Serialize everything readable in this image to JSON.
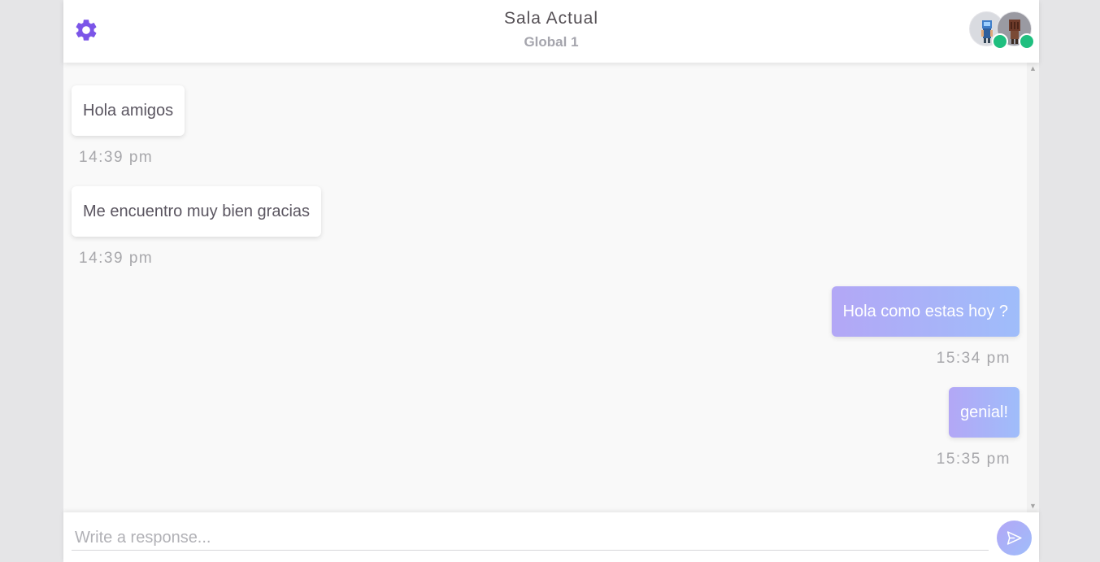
{
  "header": {
    "title": "Sala Actual",
    "subtitle": "Global 1",
    "settings_icon": "gear-icon",
    "online_color": "#1fbf7f",
    "accent_color": "#7b55e8"
  },
  "messages": [
    {
      "side": "left",
      "text": "Hola amigos",
      "time": "14:39 pm"
    },
    {
      "side": "left",
      "text": "Me encuentro muy bien gracias",
      "time": "14:39 pm"
    },
    {
      "side": "right",
      "text": "Hola como estas hoy ?",
      "time": "15:34 pm"
    },
    {
      "side": "right",
      "text": "genial!",
      "time": "15:35 pm"
    }
  ],
  "composer": {
    "placeholder": "Write a response...",
    "send_icon": "send-icon"
  }
}
